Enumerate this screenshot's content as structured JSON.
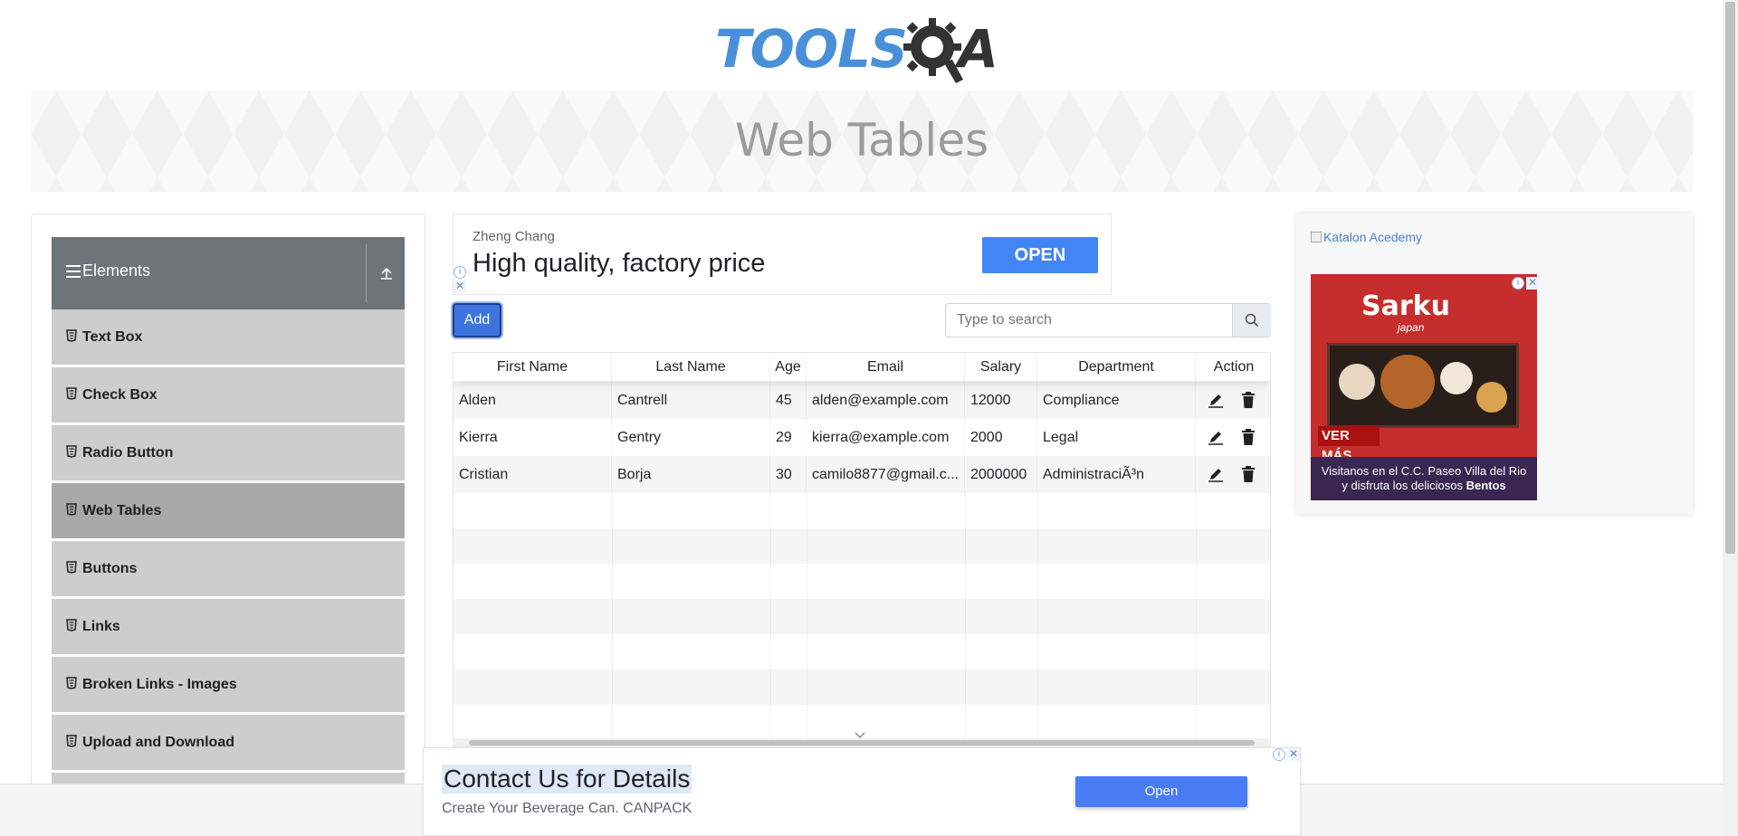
{
  "logo": {
    "part1": "TOOLS",
    "part2": "A",
    "gear_icon": "gear-q-icon"
  },
  "banner": {
    "title": "Web Tables"
  },
  "sidebar": {
    "group_title": "Elements",
    "group_icon": "hamburger-icon",
    "collapse_icon": "upload-arrow-icon",
    "items": [
      {
        "label": "Text Box",
        "active": false
      },
      {
        "label": "Check Box",
        "active": false
      },
      {
        "label": "Radio Button",
        "active": false
      },
      {
        "label": "Web Tables",
        "active": true
      },
      {
        "label": "Buttons",
        "active": false
      },
      {
        "label": "Links",
        "active": false
      },
      {
        "label": "Broken Links - Images",
        "active": false
      },
      {
        "label": "Upload and Download",
        "active": false
      }
    ]
  },
  "ad_top": {
    "advertiser": "Zheng Chang",
    "headline": "High quality, factory price",
    "button": "OPEN"
  },
  "controls": {
    "add_label": "Add",
    "search_placeholder": "Type to search"
  },
  "table": {
    "headers": [
      "First Name",
      "Last Name",
      "Age",
      "Email",
      "Salary",
      "Department",
      "Action"
    ],
    "rows": [
      {
        "first": "Alden",
        "last": "Cantrell",
        "age": "45",
        "email": "alden@example.com",
        "salary": "12000",
        "department": "Compliance"
      },
      {
        "first": "Kierra",
        "last": "Gentry",
        "age": "29",
        "email": "kierra@example.com",
        "salary": "2000",
        "department": "Legal"
      },
      {
        "first": "Cristian",
        "last": "Borja",
        "age": "30",
        "email": "camilo8877@gmail.c...",
        "salary": "2000000",
        "department": "AdministraciÃ³n"
      }
    ],
    "empty_rows": 7
  },
  "right_ad": {
    "alt_text": "Katalon Acedemy",
    "brand": "Sarku",
    "brand_sub": "japan",
    "cta": "VER MÁS",
    "caption_line1": "Visitanos en el C.C. Paseo Villa del Rio",
    "caption_line2_prefix": "y disfruta los deliciosos ",
    "caption_line2_bold": "Bentos"
  },
  "ad_bottom": {
    "headline": "Contact Us for Details",
    "subline": "Create Your Beverage Can. CANPACK",
    "button": "Open"
  },
  "colors": {
    "sidebar_header": "#6e7478",
    "menu_item": "#cdcdcd",
    "menu_active": "#a9a9a9",
    "primary": "#3d74de",
    "logo_blue": "#4a90d9"
  }
}
